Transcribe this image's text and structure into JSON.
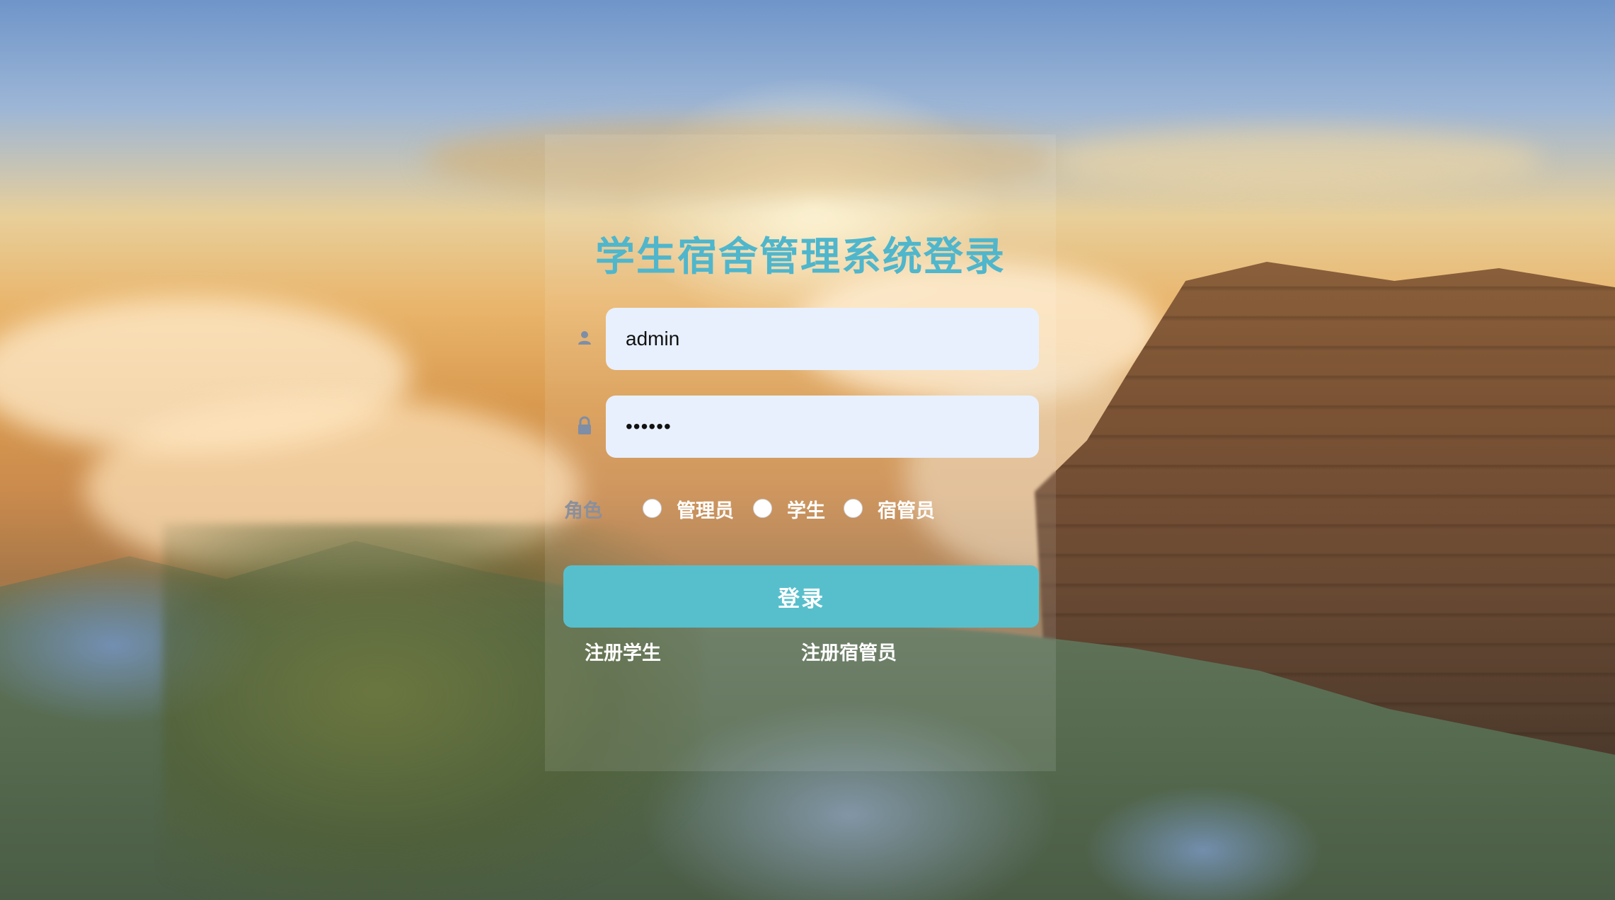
{
  "title": "学生宿舍管理系统登录",
  "username": {
    "value": "admin",
    "icon": "user-icon"
  },
  "password": {
    "value": "••••••",
    "icon": "lock-icon"
  },
  "role": {
    "label": "角色",
    "options": [
      "管理员",
      "学生",
      "宿管员"
    ]
  },
  "login_label": "登录",
  "links": {
    "register_student": "注册学生",
    "register_dorm_manager": "注册宿管员"
  },
  "colors": {
    "accent": "#57bfcc",
    "title": "#4fb6cc",
    "input_bg": "#e8f0fe"
  }
}
